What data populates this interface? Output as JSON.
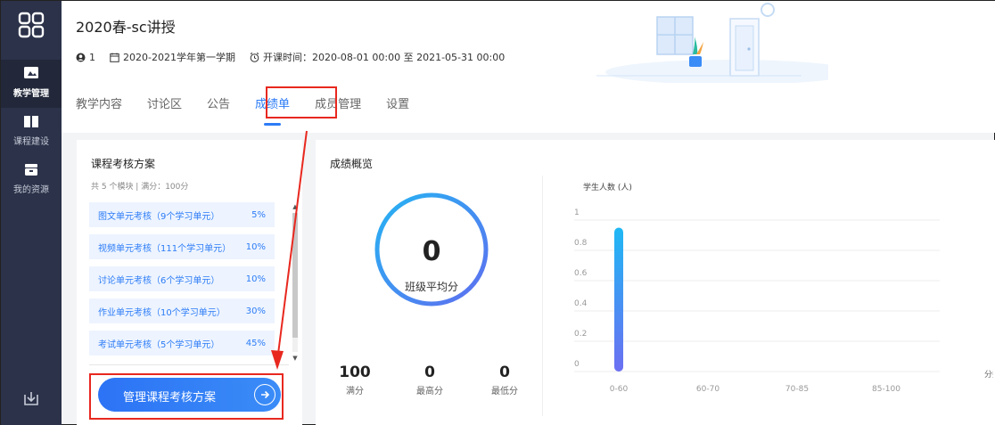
{
  "sidebar": {
    "items": [
      {
        "label": "教学管理",
        "icon": "teaching-icon",
        "active": true
      },
      {
        "label": "课程建设",
        "icon": "book-icon",
        "active": false
      },
      {
        "label": "我的资源",
        "icon": "resource-icon",
        "active": false
      }
    ],
    "bottom_icon": "download-icon"
  },
  "header": {
    "title": "2020春-sc讲授",
    "members": "1",
    "term": "2020-2021学年第一学期",
    "course_time": "开课时间：2020-08-01 00:00 至 2021-05-31 00:00"
  },
  "tabs": [
    {
      "label": "教学内容",
      "active": false
    },
    {
      "label": "讨论区",
      "active": false
    },
    {
      "label": "公告",
      "active": false
    },
    {
      "label": "成绩单",
      "active": true
    },
    {
      "label": "成员管理",
      "active": false
    },
    {
      "label": "设置",
      "active": false
    }
  ],
  "plan": {
    "title": "课程考核方案",
    "subtitle": "共 5 个模块 | 满分：100分",
    "items": [
      {
        "name": "图文单元考核（9个学习单元）",
        "percent": "5%"
      },
      {
        "name": "视频单元考核（111个学习单元）",
        "percent": "10%"
      },
      {
        "name": "讨论单元考核（6个学习单元）",
        "percent": "10%"
      },
      {
        "name": "作业单元考核（10个学习单元）",
        "percent": "30%"
      },
      {
        "name": "考试单元考核（5个学习单元）",
        "percent": "45%"
      }
    ],
    "manage_button": "管理课程考核方案"
  },
  "overview": {
    "title": "成绩概览",
    "avg_value": "0",
    "avg_label": "班级平均分",
    "stats": [
      {
        "value": "100",
        "label": "满分"
      },
      {
        "value": "0",
        "label": "最高分"
      },
      {
        "value": "0",
        "label": "最低分"
      }
    ]
  },
  "colors": {
    "accent": "#2d7cf6",
    "sidebar": "#2b3249",
    "highlight": "#e8281f"
  },
  "chart_data": {
    "type": "bar",
    "title": "",
    "ylabel": "学生人数 (人)",
    "xlabel": "分数",
    "categories": [
      "0-60",
      "60-70",
      "70-85",
      "85-100"
    ],
    "values": [
      0.95,
      0,
      0,
      0
    ],
    "yticks": [
      "0",
      "0.2",
      "0.4",
      "0.6",
      "0.8",
      "1"
    ],
    "ylim": [
      0,
      1
    ],
    "grid": true
  }
}
